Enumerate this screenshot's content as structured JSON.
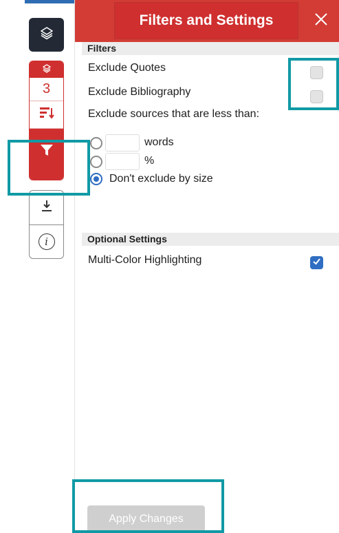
{
  "header": {
    "title": "Filters and Settings",
    "close_icon": "close-icon"
  },
  "toolbar": {
    "layers_icon": "layers-icon",
    "match_count": "3",
    "sort_icon": "sort-icon",
    "filter_icon": "filter-icon",
    "download_icon": "download-icon",
    "info_label": "i",
    "accent_color": "#cf2f2f",
    "dark_color": "#232a36"
  },
  "filters": {
    "section_title": "Filters",
    "exclude_quotes": {
      "label": "Exclude Quotes",
      "checked": false
    },
    "exclude_bibliography": {
      "label": "Exclude Bibliography",
      "checked": false
    },
    "size_prompt": "Exclude sources that are less than:",
    "words_option": {
      "unit": "words",
      "value": "",
      "selected": false
    },
    "percent_option": {
      "unit": "%",
      "value": "",
      "selected": false
    },
    "no_size_option": {
      "label": "Don't exclude by size",
      "selected": true
    }
  },
  "optional": {
    "section_title": "Optional Settings",
    "multi_color": {
      "label": "Multi-Color Highlighting",
      "checked": true
    }
  },
  "footer": {
    "apply_label": "Apply Changes"
  },
  "highlight_color": "#109aa5",
  "checkbox_color": "#2f6ec2"
}
